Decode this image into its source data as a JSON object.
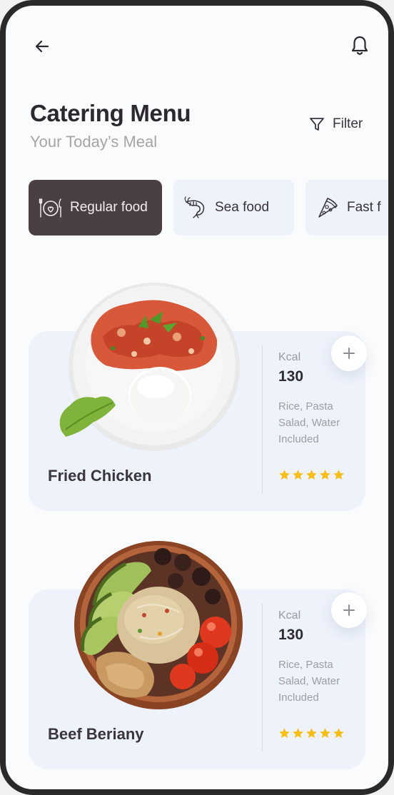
{
  "header": {
    "title": "Catering Menu",
    "subtitle": "Your Today’s Meal",
    "filter_label": "Filter"
  },
  "categories": [
    {
      "label": "Regular food",
      "icon": "plate-cutlery-icon",
      "active": true
    },
    {
      "label": "Sea food",
      "icon": "shrimp-icon",
      "active": false
    },
    {
      "label": "Fast f",
      "icon": "pizza-slice-icon",
      "active": false
    }
  ],
  "menu_items": [
    {
      "name": "Fried Chicken",
      "kcal_label": "Kcal",
      "kcal": "130",
      "description": "Rice, Pasta Salad, Water Included",
      "rating": 5
    },
    {
      "name": "Beef Beriany",
      "kcal_label": "Kcal",
      "kcal": "130",
      "description": "Rice, Pasta Salad, Water Included",
      "rating": 5
    }
  ],
  "colors": {
    "active_chip": "#4a4044",
    "card_background": "#edf2fb",
    "star": "#f8be12",
    "text_dark": "#2c2830",
    "text_muted": "#a7a4a9"
  }
}
